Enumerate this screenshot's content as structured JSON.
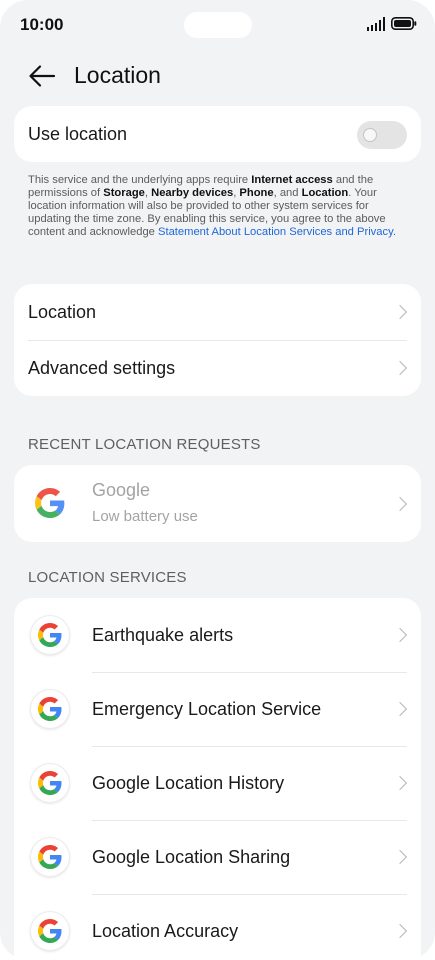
{
  "status": {
    "time": "10:00"
  },
  "header": {
    "title": "Location"
  },
  "use_location": {
    "label": "Use location",
    "enabled": false
  },
  "description": {
    "t1": "This service and the underlying apps require ",
    "b1": "Internet access",
    "t2": " and the permissions of ",
    "b2": "Storage",
    "t3": ", ",
    "b3": "Nearby devices",
    "t4": ", ",
    "b4": "Phone",
    "t5": ", and ",
    "b5": "Location",
    "t6": ". Your location information will also be provided to other system services for updating the time zone. By enabling this service, you agree to the above content and acknowledge ",
    "link": "Statement About Location Services and Privacy",
    "t7": "."
  },
  "menu": {
    "location": "Location",
    "advanced": "Advanced settings"
  },
  "recent": {
    "header": "RECENT LOCATION REQUESTS",
    "app_name": "Google",
    "app_sub": "Low battery use"
  },
  "services": {
    "header": "LOCATION SERVICES",
    "items": [
      "Earthquake alerts",
      "Emergency Location Service",
      "Google Location History",
      "Google Location Sharing",
      "Location Accuracy"
    ]
  },
  "colors": {
    "background": "#f1f3f5",
    "card": "#ffffff",
    "link": "#2168d6",
    "google_blue": "#4285f4",
    "google_red": "#ea4335",
    "google_yellow": "#fbbc05",
    "google_green": "#34a853"
  }
}
